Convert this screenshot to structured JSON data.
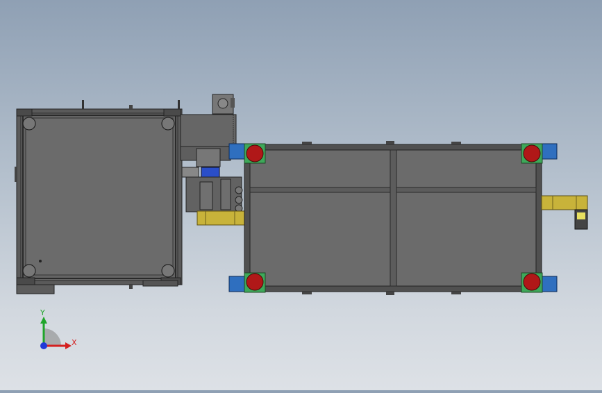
{
  "viewport": {
    "background_top": "#8fa0b4",
    "background_bottom": "#dde1e6"
  },
  "triad": {
    "x_label": "X",
    "y_label": "Y",
    "x_color": "#d42020",
    "y_color": "#1fa52a",
    "z_color": "#2038d8"
  },
  "colors": {
    "frame": "#3c3c3c",
    "panel": "#6a6a6a",
    "conveyor": "#c8b33a",
    "foot_pad": "#2f6fbf",
    "foot_wheel": "#b01818",
    "foot_base": "#3ea85a"
  }
}
